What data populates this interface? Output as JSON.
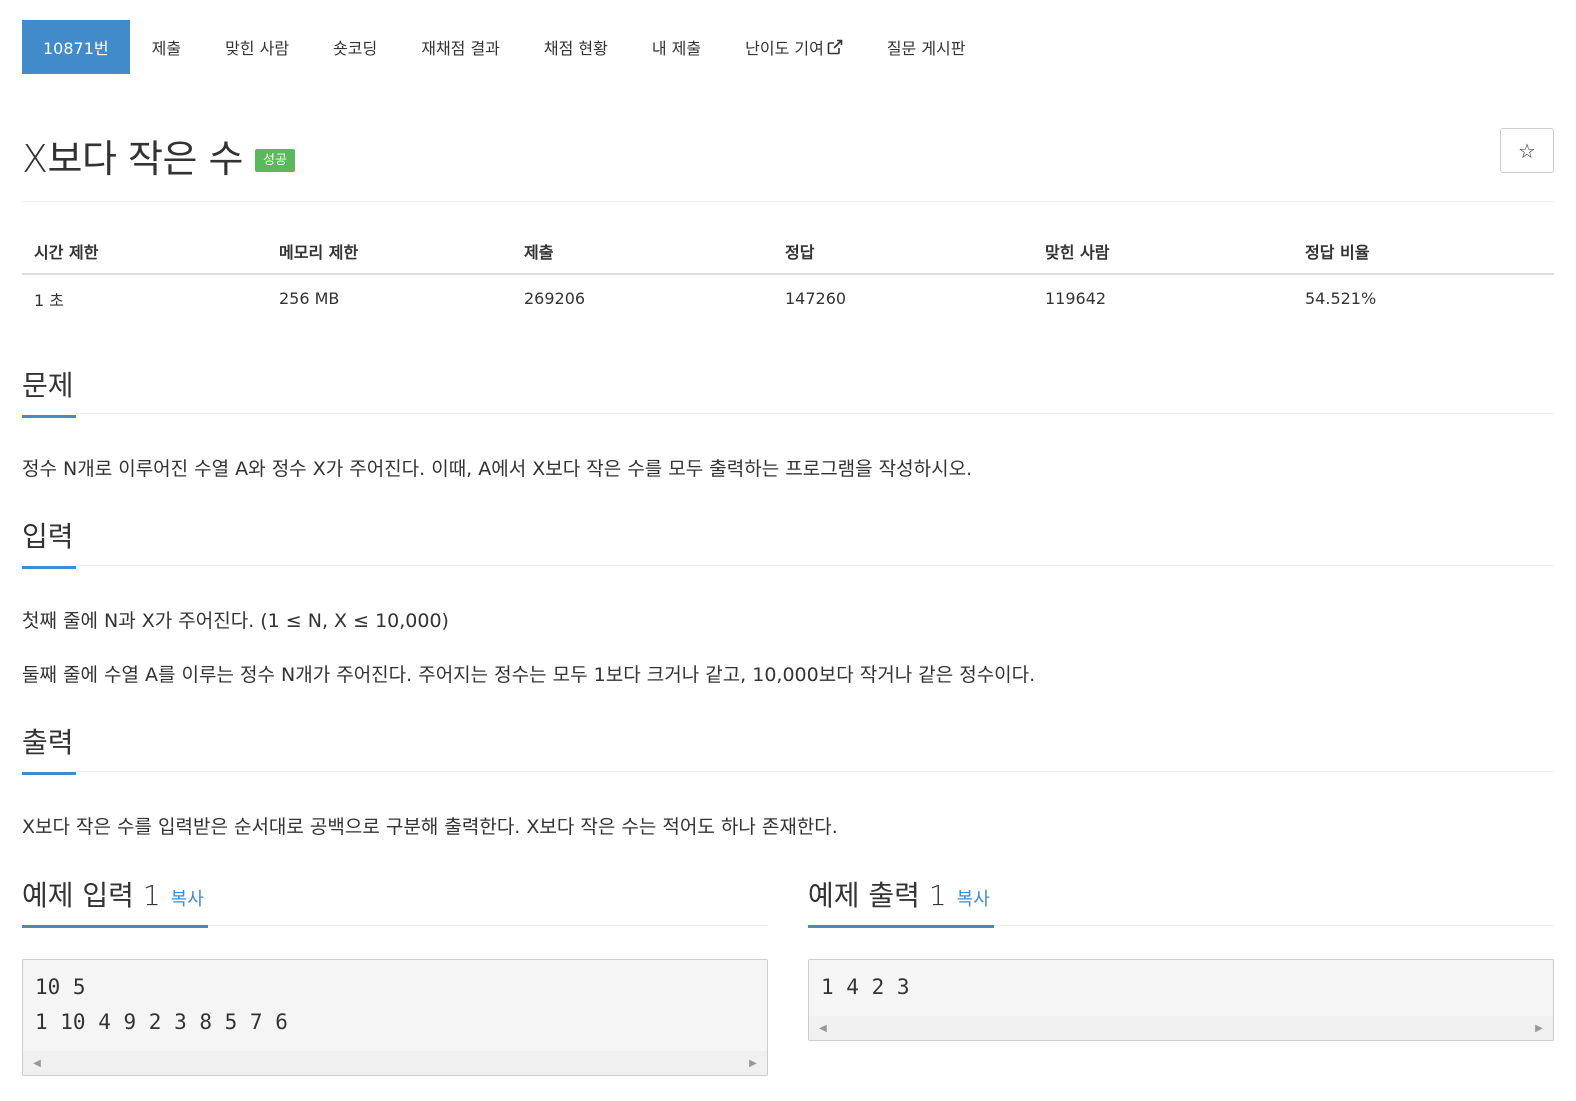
{
  "nav": {
    "items": [
      {
        "label": "10871번"
      },
      {
        "label": "제출"
      },
      {
        "label": "맞힌 사람"
      },
      {
        "label": "숏코딩"
      },
      {
        "label": "재채점 결과"
      },
      {
        "label": "채점 현황"
      },
      {
        "label": "내 제출"
      },
      {
        "label": "난이도 기여"
      },
      {
        "label": "질문 게시판"
      }
    ],
    "active_color": "#428bca"
  },
  "problem": {
    "title": "X보다 작은 수",
    "badge": "성공",
    "badge_color": "#5cb85c",
    "star_icon": "☆"
  },
  "info": {
    "headers": [
      "시간 제한",
      "메모리 제한",
      "제출",
      "정답",
      "맞힌 사람",
      "정답 비율"
    ],
    "values": [
      "1 초",
      "256 MB",
      "269206",
      "147260",
      "119642",
      "54.521%"
    ]
  },
  "sections": {
    "description": {
      "title": "문제",
      "text": "정수 N개로 이루어진 수열 A와 정수 X가 주어진다. 이때, A에서 X보다 작은 수를 모두 출력하는 프로그램을 작성하시오."
    },
    "input": {
      "title": "입력",
      "lines": [
        "첫째 줄에 N과 X가 주어진다. (1 ≤ N, X ≤ 10,000)",
        "둘째 줄에 수열 A를 이루는 정수 N개가 주어진다. 주어지는 정수는 모두 1보다 크거나 같고, 10,000보다 작거나 같은 정수이다."
      ]
    },
    "output": {
      "title": "출력",
      "text": "X보다 작은 수를 입력받은 순서대로 공백으로 구분해 출력한다. X보다 작은 수는 적어도 하나 존재한다."
    }
  },
  "samples": {
    "input": {
      "title": "예제 입력 1",
      "copy": "복사",
      "content": "10 5\n1 10 4 9 2 3 8 5 7 6"
    },
    "output": {
      "title": "예제 출력 1",
      "copy": "복사",
      "content": "1 4 2 3"
    }
  }
}
